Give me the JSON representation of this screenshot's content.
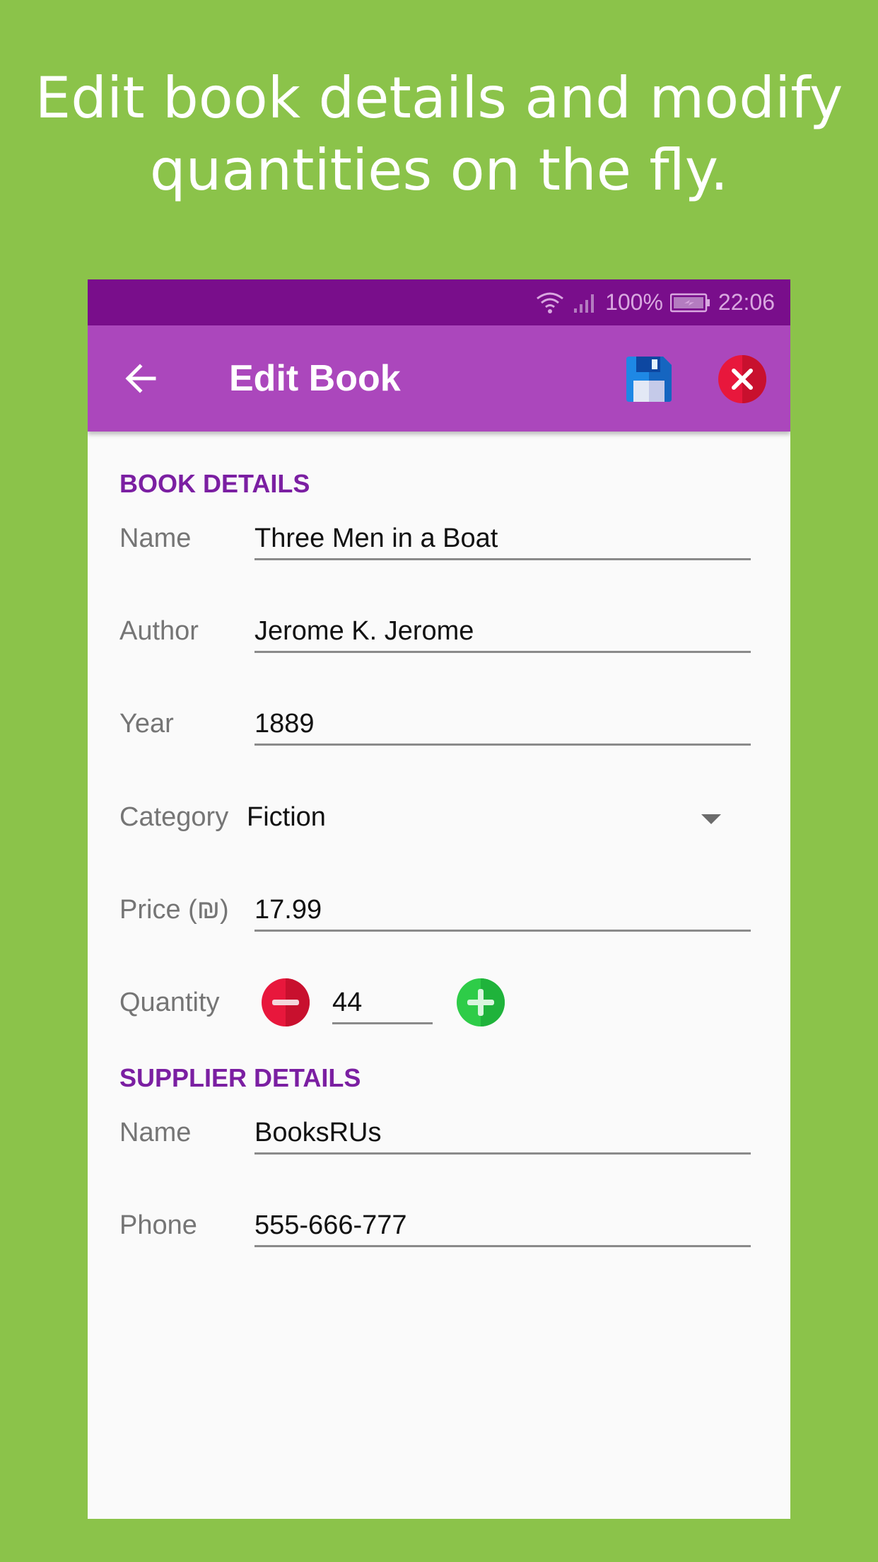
{
  "headline": {
    "line1": "Edit book details and modify",
    "line2": "quantities on the fly."
  },
  "status_bar": {
    "battery": "100%",
    "time": "22:06",
    "icons": [
      "wifi-icon",
      "signal-icon",
      "battery-icon"
    ]
  },
  "app_bar": {
    "title": "Edit Book",
    "icons": [
      "back-arrow-icon",
      "floppy-disk-icon",
      "close-icon"
    ]
  },
  "book_details": {
    "section_title": "BOOK DETAILS",
    "name": {
      "label": "Name",
      "value": "Three Men in a Boat"
    },
    "author": {
      "label": "Author",
      "value": "Jerome K. Jerome"
    },
    "year": {
      "label": "Year",
      "value": "1889"
    },
    "category": {
      "label": "Category",
      "value": "Fiction"
    },
    "price": {
      "label": "Price (₪)",
      "value": "17.99"
    },
    "quantity": {
      "label": "Quantity",
      "value": "44"
    }
  },
  "supplier_details": {
    "section_title": "SUPPLIER DETAILS",
    "name": {
      "label": "Name",
      "value": "BooksRUs"
    },
    "phone": {
      "label": "Phone",
      "value": "555-666-777"
    }
  },
  "colors": {
    "background": "#8bc34a",
    "status_bar": "#790e8b",
    "app_bar": "#ab47bc",
    "section_title": "#7b1fa2",
    "minus_button": "#e8173c",
    "plus_button": "#2ecc48"
  }
}
